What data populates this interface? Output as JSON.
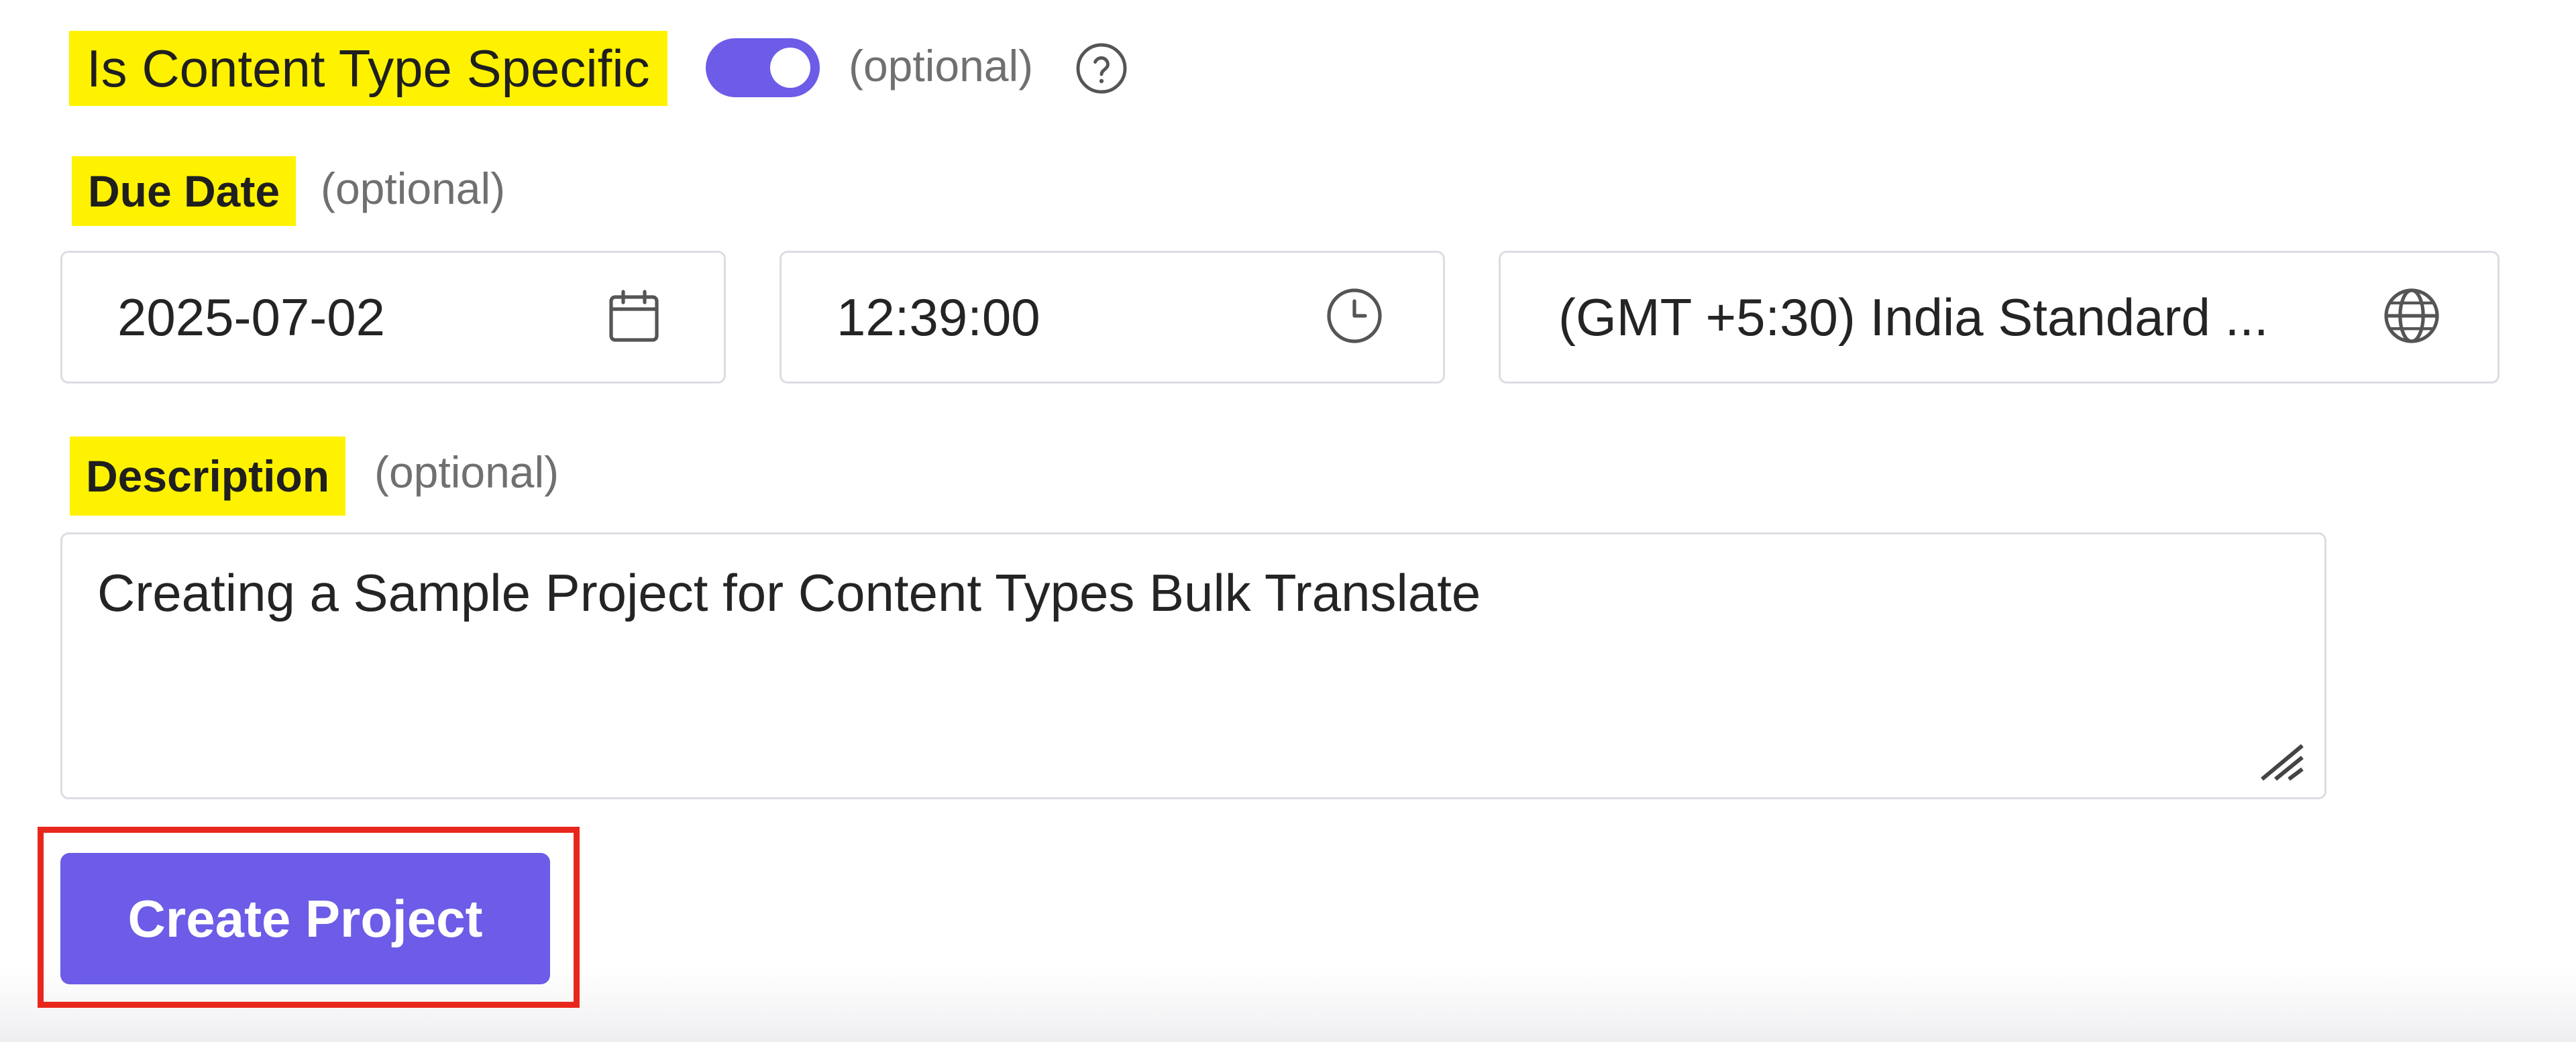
{
  "content_type": {
    "label": "Is Content Type Specific",
    "toggle_on": true,
    "optional": "(optional)",
    "help_icon": "question-circle-icon"
  },
  "due_date": {
    "label": "Due Date",
    "optional": "(optional)",
    "date": "2025-07-02",
    "date_icon": "calendar-icon",
    "time": "12:39:00",
    "time_icon": "clock-icon",
    "timezone": "(GMT +5:30) India Standard ...",
    "timezone_icon": "globe-icon"
  },
  "description": {
    "label": "Description",
    "optional": "(optional)",
    "value": "Creating a Sample Project for Content Types Bulk Translate",
    "resize_icon": "resize-handle-icon"
  },
  "actions": {
    "create_label": "Create Project"
  },
  "colors": {
    "accent": "#6c5ce7",
    "highlight": "#fff200",
    "callout_border": "#e8271c"
  }
}
